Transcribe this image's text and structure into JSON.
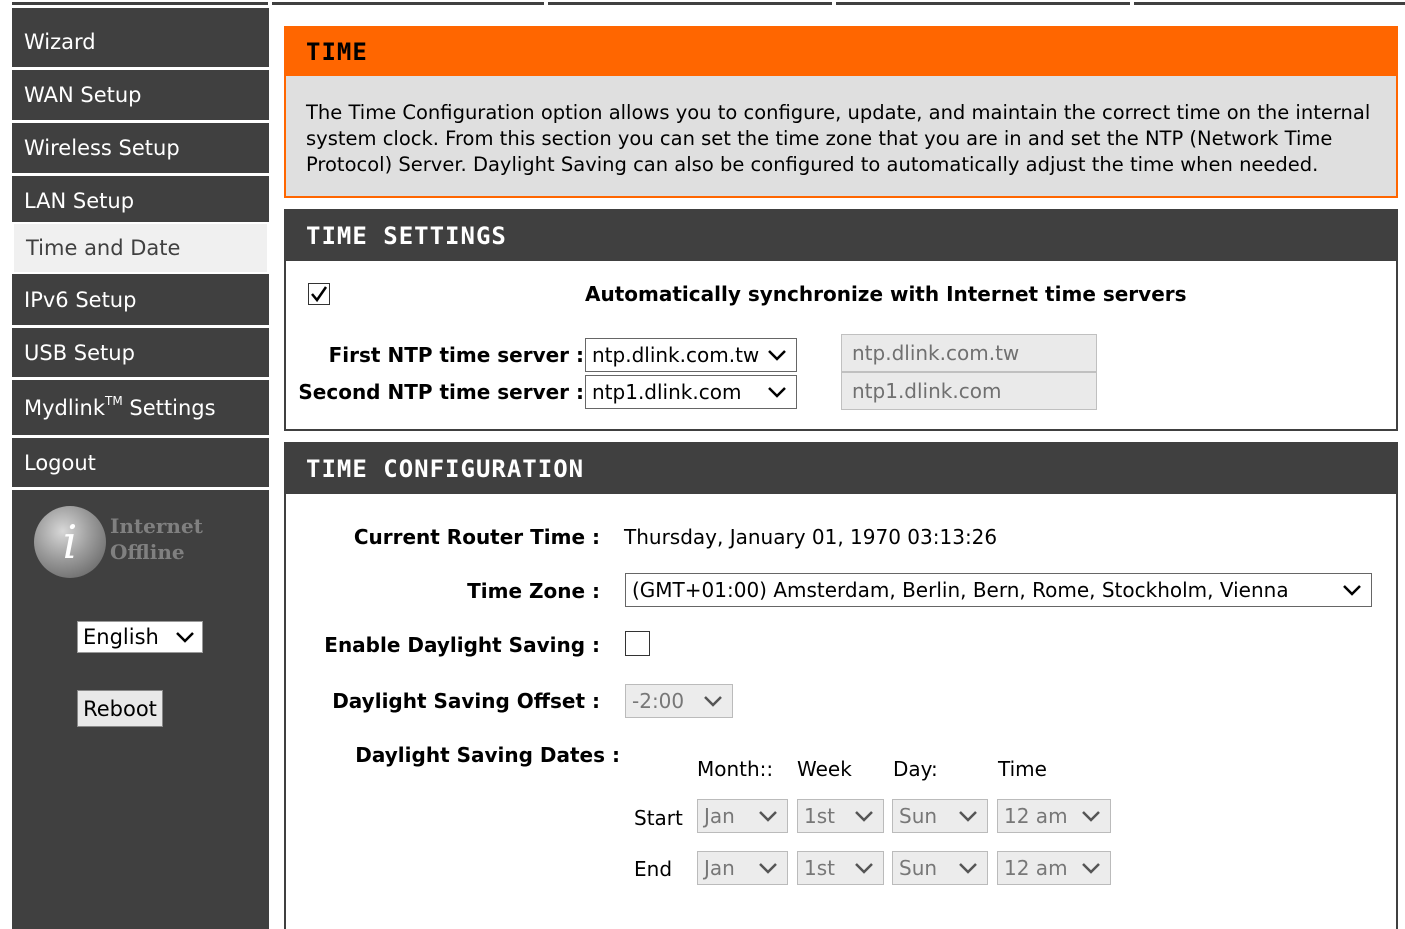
{
  "nav": {
    "items": [
      {
        "label": "Wizard",
        "name": "sidebar-item-wizard"
      },
      {
        "label": "WAN Setup",
        "name": "sidebar-item-wan-setup"
      },
      {
        "label": "Wireless Setup",
        "name": "sidebar-item-wireless-setup"
      },
      {
        "label": "LAN Setup",
        "name": "sidebar-item-lan-setup"
      },
      {
        "label": "Time and Date",
        "name": "sidebar-item-time-and-date"
      },
      {
        "label": "IPv6 Setup",
        "name": "sidebar-item-ipv6-setup"
      },
      {
        "label": "USB Setup",
        "name": "sidebar-item-usb-setup"
      },
      {
        "label": "Settings",
        "name": "sidebar-item-mydlink-settings"
      },
      {
        "label": "Logout",
        "name": "sidebar-item-logout"
      }
    ],
    "mydlink_prefix": "Mydlink",
    "mydlink_sup": "TM",
    "active": "Time and Date"
  },
  "status": {
    "icon": "info-icon",
    "icon_glyph": "i",
    "line1": "Internet",
    "line2": "Offline"
  },
  "language": {
    "selected": "English"
  },
  "reboot_label": "Reboot",
  "time_panel": {
    "title": "TIME",
    "description": "The Time Configuration option allows you to configure, update, and maintain the correct time on the internal system clock. From this section you can set the time zone that you are in and set the NTP (Network Time Protocol) Server. Daylight Saving can also be configured to automatically adjust the time when needed."
  },
  "time_settings": {
    "title": "TIME SETTINGS",
    "auto_sync_checked": true,
    "auto_sync_label": "Automatically synchronize with Internet time servers",
    "first_ntp_label": "First NTP time server :",
    "first_ntp_selected": "ntp.dlink.com.tw",
    "first_ntp_value": "ntp.dlink.com.tw",
    "second_ntp_label": "Second NTP time server :",
    "second_ntp_selected": "ntp1.dlink.com",
    "second_ntp_value": "ntp1.dlink.com"
  },
  "time_config": {
    "title": "TIME CONFIGURATION",
    "router_time_label": "Current Router Time :",
    "router_time_value": "Thursday, January 01, 1970 03:13:26",
    "time_zone_label": "Time Zone :",
    "time_zone_selected": "(GMT+01:00) Amsterdam, Berlin, Bern, Rome, Stockholm, Vienna",
    "dst_enable_label": "Enable Daylight Saving :",
    "dst_enabled": false,
    "dst_offset_label": "Daylight Saving Offset :",
    "dst_offset_selected": "-2:00",
    "dst_dates_label": "Daylight Saving Dates :",
    "columns": {
      "month": "Month::",
      "week": "Week",
      "day": "Day:",
      "time": "Time"
    },
    "start": {
      "label": "Start",
      "month": "Jan",
      "week": "1st",
      "day": "Sun",
      "time": "12 am"
    },
    "end": {
      "label": "End",
      "month": "Jan",
      "week": "1st",
      "day": "Sun",
      "time": "12 am"
    }
  },
  "colors": {
    "accent": "#ff6600",
    "nav_bg": "#404040",
    "panel_bg": "#dfdfdf"
  }
}
